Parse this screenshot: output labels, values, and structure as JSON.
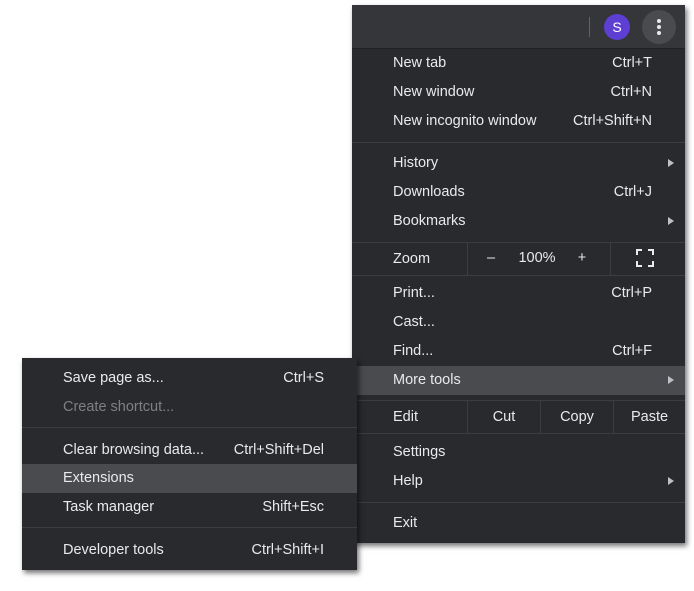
{
  "profile": {
    "initial": "S"
  },
  "main_menu": {
    "new_tab": {
      "label": "New tab",
      "shortcut": "Ctrl+T"
    },
    "new_window": {
      "label": "New window",
      "shortcut": "Ctrl+N"
    },
    "new_incognito": {
      "label": "New incognito window",
      "shortcut": "Ctrl+Shift+N"
    },
    "history": {
      "label": "History"
    },
    "downloads": {
      "label": "Downloads",
      "shortcut": "Ctrl+J"
    },
    "bookmarks": {
      "label": "Bookmarks"
    },
    "zoom": {
      "label": "Zoom",
      "minus": "–",
      "value": "100%",
      "plus": "+"
    },
    "print": {
      "label": "Print...",
      "shortcut": "Ctrl+P"
    },
    "cast": {
      "label": "Cast..."
    },
    "find": {
      "label": "Find...",
      "shortcut": "Ctrl+F"
    },
    "more_tools": {
      "label": "More tools"
    },
    "edit": {
      "label": "Edit",
      "cut": "Cut",
      "copy": "Copy",
      "paste": "Paste"
    },
    "settings": {
      "label": "Settings"
    },
    "help": {
      "label": "Help"
    },
    "exit": {
      "label": "Exit"
    }
  },
  "sub_menu": {
    "save_page": {
      "label": "Save page as...",
      "shortcut": "Ctrl+S"
    },
    "create_shortcut": {
      "label": "Create shortcut..."
    },
    "clear_data": {
      "label": "Clear browsing data...",
      "shortcut": "Ctrl+Shift+Del"
    },
    "extensions": {
      "label": "Extensions"
    },
    "task_manager": {
      "label": "Task manager",
      "shortcut": "Shift+Esc"
    },
    "developer_tools": {
      "label": "Developer tools",
      "shortcut": "Ctrl+Shift+I"
    }
  },
  "icons": {
    "kebab": "vertical-dots-icon",
    "fullscreen": "fullscreen-icon",
    "submenu_arrow": "chevron-right-icon"
  },
  "colors": {
    "menu_bg": "#292a2d",
    "header_bg": "#35363a",
    "highlight": "#4a4b4f",
    "text": "#e8eaed",
    "disabled_text": "#7d8084",
    "avatar": "#5d3fd3"
  }
}
